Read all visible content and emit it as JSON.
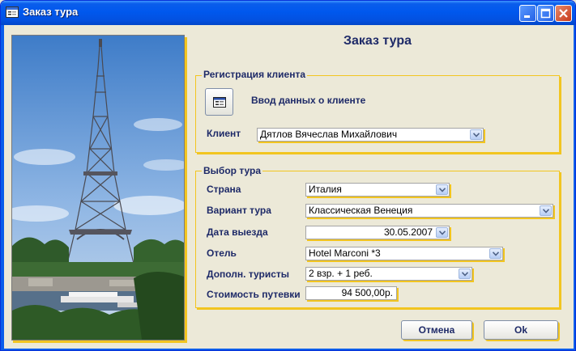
{
  "window": {
    "title": "Заказ тура",
    "icon": "form-icon",
    "controls": [
      "minimize-icon",
      "maximize-icon",
      "close-icon"
    ]
  },
  "form": {
    "title": "Заказ тура"
  },
  "client_group": {
    "legend": "Регистрация клиента",
    "entry_button_icon": "form-icon",
    "entry_label": "Ввод данных о клиенте",
    "client_label": "Клиент",
    "client_value": "Дятлов Вячеслав Михайлович"
  },
  "tour_group": {
    "legend": "Выбор тура",
    "country_label": "Страна",
    "country_value": "Италия",
    "variant_label": "Вариант тура",
    "variant_value": "Классическая Венеция",
    "date_label": "Дата выезда",
    "date_value": "30.05.2007",
    "hotel_label": "Отель",
    "hotel_value": "Hotel Marconi *3",
    "tourists_label": "Дополн. туристы",
    "tourists_value": "2 взр. + 1 реб.",
    "price_label": "Стоимость путевки",
    "price_value": "94 500,00р."
  },
  "buttons": {
    "cancel": "Отмена",
    "ok": "Ok"
  },
  "colors": {
    "accent": "#F2C520",
    "label_text": "#1E2A68",
    "titlebar": "#0058EE"
  }
}
